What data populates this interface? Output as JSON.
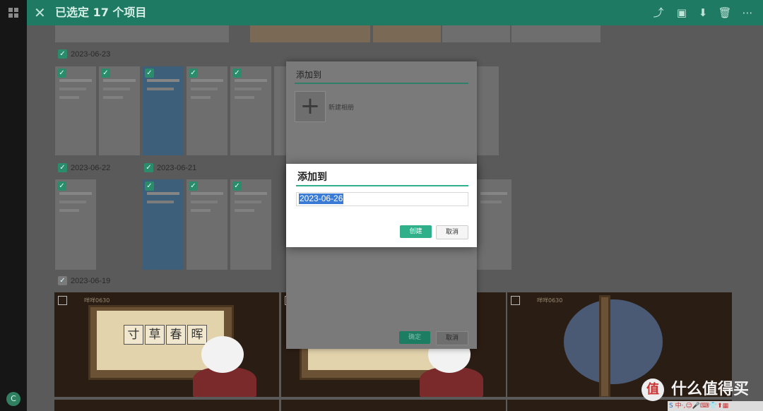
{
  "topbar": {
    "title": "已选定 17 个项目",
    "close_icon": "close-icon",
    "actions": [
      "share-icon",
      "add-to-album-icon",
      "download-icon",
      "delete-icon",
      "more-icon"
    ]
  },
  "dates": [
    "2023-06-23",
    "2023-06-22",
    "2023-06-21",
    "2023-06-19"
  ],
  "video": {
    "label": "咩咩0630",
    "chars": [
      "寸",
      "草",
      "春",
      "晖"
    ]
  },
  "back_dialog": {
    "title": "添加到",
    "new_album_label": "新建相册",
    "ok_label": "确定",
    "cancel_label": "取消"
  },
  "front_dialog": {
    "title": "添加到",
    "input_value": "2023-06-26",
    "create_label": "创建",
    "cancel_label": "取消"
  },
  "watermark": {
    "circle_char": "值",
    "text": "什么值得买"
  },
  "ime": {
    "lead": "S",
    "text": "中·,☺🎤⌨👕⬆▦"
  },
  "rail": {
    "avatar_letter": "C"
  },
  "colors": {
    "accent": "#2fb08a",
    "topbar": "#1f7a63",
    "selection": "#3a7bd5"
  }
}
